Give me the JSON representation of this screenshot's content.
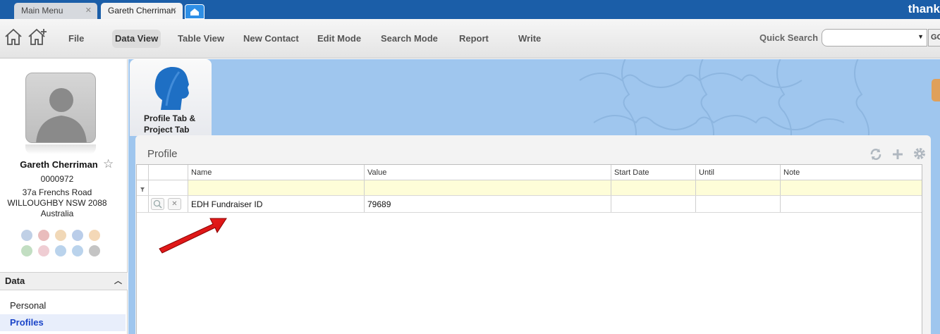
{
  "tabs": {
    "main_menu": "Main Menu",
    "gareth": "Gareth Cherriman",
    "close": "✕"
  },
  "brand": "thank",
  "toolbar": {
    "items": [
      "File",
      "Data View",
      "Table View",
      "New Contact",
      "Edit Mode",
      "Search Mode",
      "Report",
      "Write"
    ],
    "active": "Data View",
    "quick_search_label": "Quick Search",
    "quick_search_value": "",
    "go_label": "GO"
  },
  "contact": {
    "name": "Gareth Cherriman",
    "id": "0000972",
    "address_line1": "37a Frenchs Road",
    "address_line2": "WILLOUGHBY NSW 2088",
    "country": "Australia"
  },
  "sidebar": {
    "section_title": "Data",
    "items": [
      {
        "label": "Personal",
        "active": false
      },
      {
        "label": "Profiles",
        "active": true
      }
    ]
  },
  "profile_tab": {
    "label": "Profile Tab & Project Tab"
  },
  "panel": {
    "title": "Profile",
    "columns": [
      "Name",
      "Value",
      "Start Date",
      "Until",
      "Note"
    ],
    "rows": [
      {
        "name": "EDH Fundraiser ID",
        "value": "79689",
        "start_date": "",
        "until": "",
        "note": ""
      }
    ]
  },
  "colors": {
    "titlebar": "#1b5ea8",
    "background_blue": "#9fc6ee",
    "filter_row": "#fefdd8",
    "active_nav": "#1a44c8",
    "arrow": "#e0141a"
  }
}
